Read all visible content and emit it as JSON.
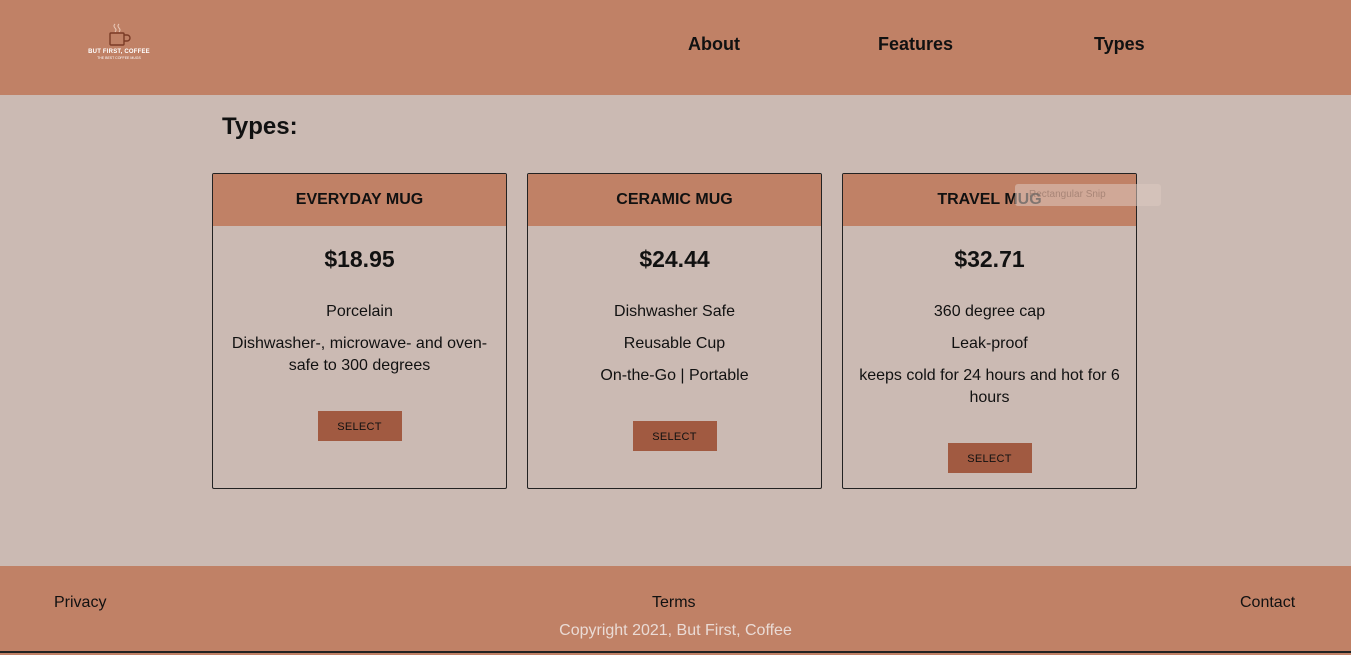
{
  "header": {
    "logo": {
      "brand": "BUT FIRST, COFFEE",
      "tagline": "THE BEST COFFEE MUGS"
    },
    "nav": [
      {
        "label": "About"
      },
      {
        "label": "Features"
      },
      {
        "label": "Types"
      }
    ]
  },
  "main": {
    "title": "Types:",
    "cards": [
      {
        "name": "EVERYDAY MUG",
        "price": "$18.95",
        "features": [
          "Porcelain",
          "Dishwasher-, microwave- and oven-safe to 300 degrees"
        ],
        "button": "SELECT"
      },
      {
        "name": "CERAMIC MUG",
        "price": "$24.44",
        "features": [
          "Dishwasher Safe",
          "Reusable Cup",
          "On-the-Go | Portable"
        ],
        "button": "SELECT"
      },
      {
        "name": "TRAVEL MUG",
        "price": "$32.71",
        "features": [
          "360 degree cap",
          "Leak-proof",
          "keeps cold for 24 hours and hot for 6 hours"
        ],
        "button": "SELECT"
      }
    ],
    "overlay": "Rectangular Snip"
  },
  "footer": {
    "links": [
      {
        "label": "Privacy"
      },
      {
        "label": "Terms"
      },
      {
        "label": "Contact"
      }
    ],
    "copyright": "Copyright 2021, But First, Coffee"
  },
  "colors": {
    "header_bg": "#c08166",
    "page_bg": "#cbbab3",
    "button_bg": "#a15a41"
  }
}
